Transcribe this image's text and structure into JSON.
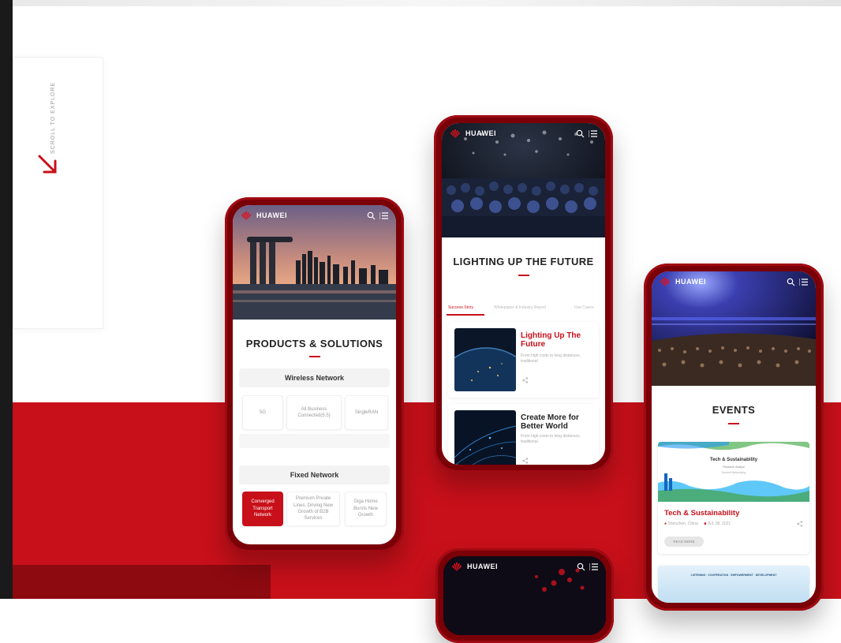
{
  "scroll": {
    "label": "SCROLL TO EXPLORE"
  },
  "brand": "HUAWEI",
  "phone1": {
    "title": "PRODUCTS & SOLUTIONS",
    "wireless": {
      "heading": "Wireless Network",
      "items": [
        "5G",
        "All Business Connected(5.5)",
        "SingleRAN"
      ]
    },
    "fixed": {
      "heading": "Fixed Network",
      "items": [
        "Converged Transport Network",
        "Premium Private Lines, Driving New Growth of B2B Services",
        "Giga Home Bursts New Growth"
      ]
    }
  },
  "phone2": {
    "title": "LIGHTING UP THE FUTURE",
    "tabs": [
      "Success Story",
      "Whitepaper & Industry Report",
      "Use Cases"
    ],
    "cards": [
      {
        "title": "Lighting Up The Future",
        "subtitle": "From high costs to long distances, traditional"
      },
      {
        "title": "Create More for Better World",
        "subtitle": "From high costs to long distances, traditional"
      }
    ]
  },
  "phone3": {
    "title": "EVENTS",
    "event": {
      "banner_title": "Tech & Sustainability",
      "banner_sub": "Research Analyst",
      "banner_sub2": "Summit  Networking",
      "title": "Tech & Sustainability",
      "location": "Shenzhen, China",
      "date": "JUL 08, 2021",
      "button": "READ MORE"
    },
    "event2": {
      "banner_title": "LISTENING · COOPERATION · EMPOWERMENT · DEVELOPMENT"
    }
  },
  "colors": {
    "accent": "#c8101a",
    "phone_frame": "#7a0008"
  },
  "icons": [
    "search-icon",
    "menu-icon",
    "arrow-down-right-icon",
    "share-icon",
    "location-icon",
    "calendar-icon"
  ]
}
